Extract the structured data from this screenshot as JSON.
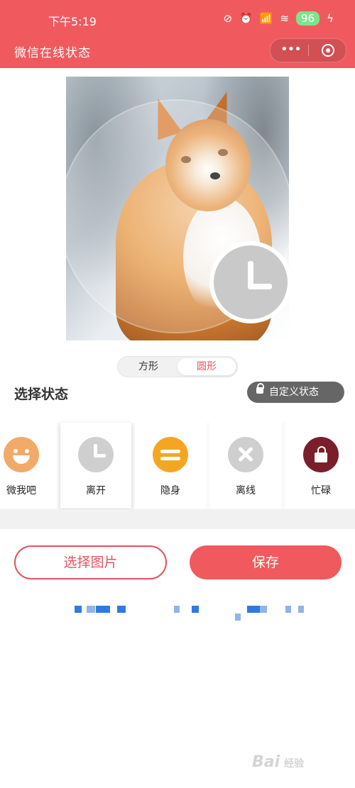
{
  "status_bar": {
    "time": "下午5:19",
    "icons": [
      "mute-icon",
      "alarm-icon",
      "signal-icon",
      "wifi-icon",
      "battery-icon",
      "charging-icon"
    ],
    "battery_level": "96"
  },
  "title_bar": {
    "title": "微信在线状态"
  },
  "shape_toggle": {
    "square_label": "方形",
    "round_label": "圆形",
    "selected": "round"
  },
  "section": {
    "title": "选择状态",
    "custom_status_label": "自定义状态"
  },
  "statuses": [
    {
      "label": "微我吧",
      "icon": "smile-icon",
      "color": "#f1aa67"
    },
    {
      "label": "离开",
      "icon": "clock-icon",
      "color": "#cfcfcf",
      "selected": true
    },
    {
      "label": "隐身",
      "icon": "equal-icon",
      "color": "#f4a623"
    },
    {
      "label": "离线",
      "icon": "close-icon",
      "color": "#cfcfcf"
    },
    {
      "label": "忙碌",
      "icon": "lock-icon",
      "color": "#7b1e2b"
    }
  ],
  "actions": {
    "choose_image_label": "选择图片",
    "save_label": "保存"
  },
  "watermark": {
    "brand": "Bai",
    "sub": "经验"
  },
  "colors": {
    "accent": "#f05a5f",
    "outline_accent": "#e5535f",
    "dark_button": "#666666"
  }
}
